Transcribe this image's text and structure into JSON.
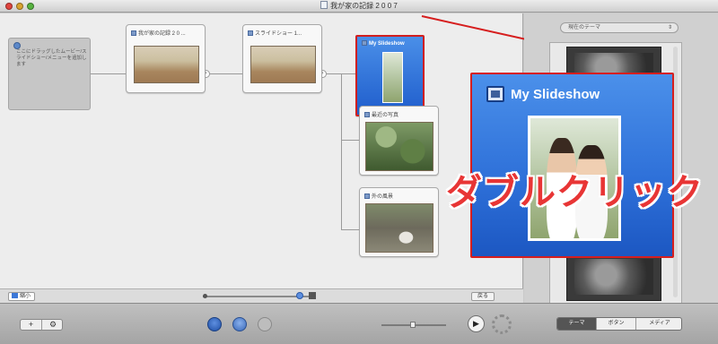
{
  "window": {
    "title": "我が家の記録 2 0 0 7"
  },
  "canvas": {
    "note": "ここにドラッグしたムービー/スライドショー/メニューを追加します",
    "nodes": [
      {
        "label": "我が家の記録 2 0 ..."
      },
      {
        "label": "スライドショー 1..."
      },
      {
        "label": "My Slideshow"
      },
      {
        "label": "最近の写真"
      },
      {
        "label": "外の風景"
      }
    ],
    "zoom_label": "縮小",
    "fit_label": "戻る"
  },
  "callout": {
    "title": "My Slideshow",
    "annotation": "ダブルクリック"
  },
  "sidebar": {
    "theme_select": "現在のテーマ"
  },
  "toolbar": {
    "add_label": "+",
    "action_label": "⚙",
    "play_label": "▶",
    "segments": [
      "テーマ",
      "ボタン",
      "メディア"
    ]
  },
  "colors": {
    "selection_blue": "#2d6fd8",
    "annotation_red": "#e83535"
  }
}
